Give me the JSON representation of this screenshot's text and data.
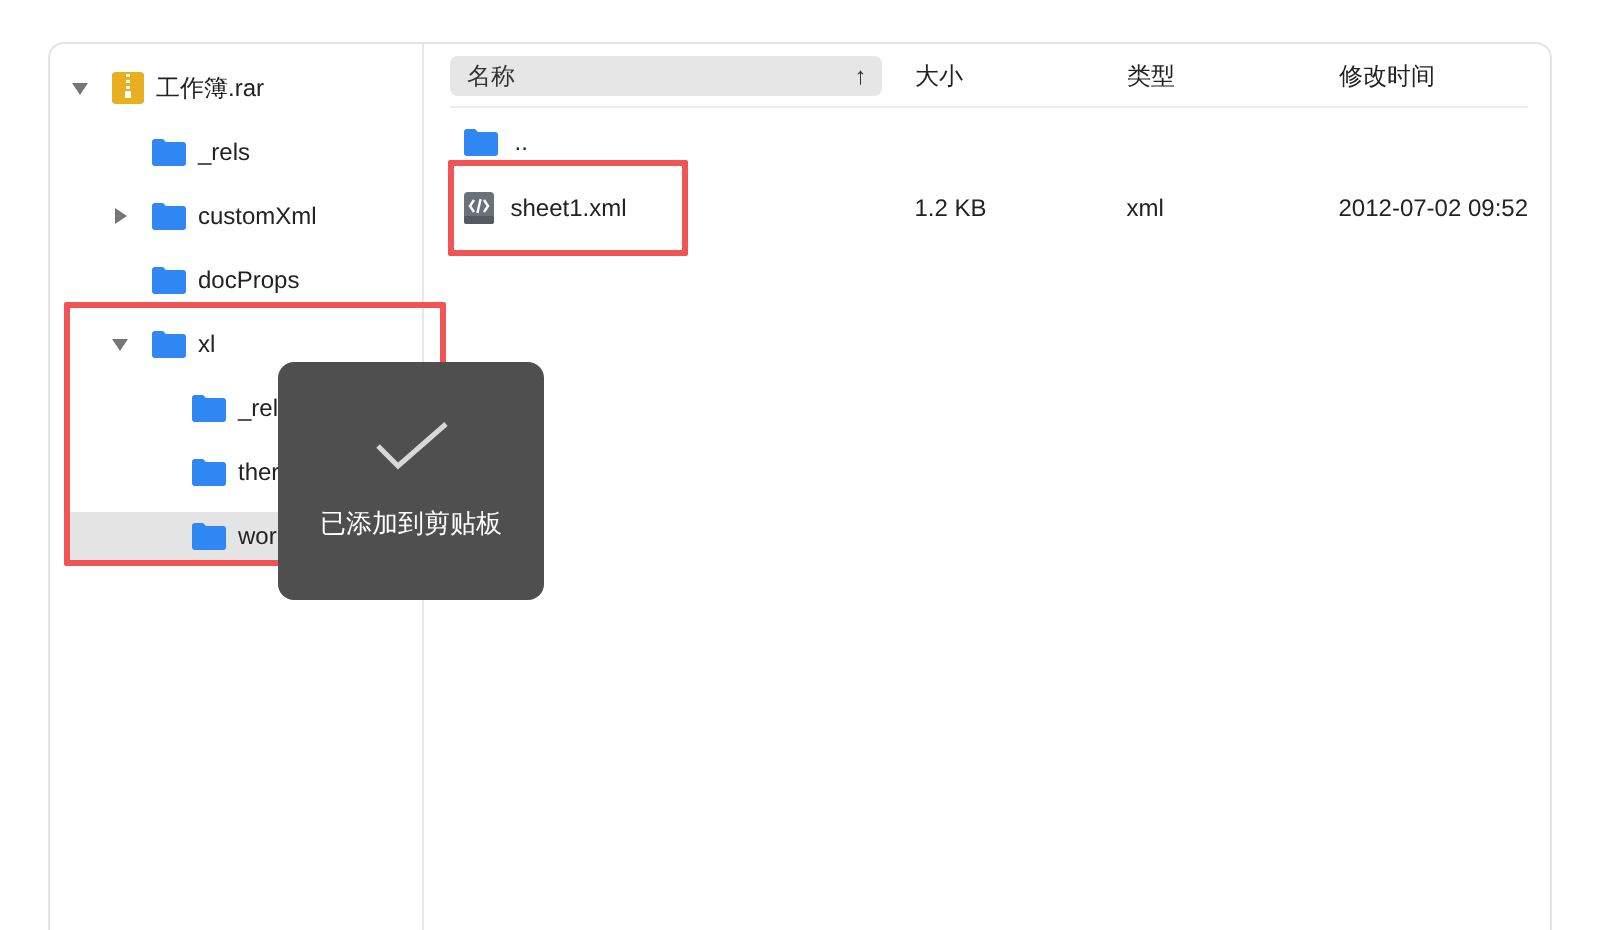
{
  "tree": [
    {
      "label": "工作簿.rar",
      "kind": "archive",
      "expandable": true,
      "expanded": true,
      "selected": false,
      "children": [
        {
          "label": "_rels",
          "kind": "folder",
          "expandable": false,
          "selected": false
        },
        {
          "label": "customXml",
          "kind": "folder",
          "expandable": true,
          "expanded": false,
          "selected": false
        },
        {
          "label": "docProps",
          "kind": "folder",
          "expandable": false,
          "selected": false
        },
        {
          "label": "xl",
          "kind": "folder",
          "expandable": true,
          "expanded": true,
          "selected": false,
          "children": [
            {
              "label": "_rel",
              "kind": "folder",
              "expandable": false,
              "selected": false
            },
            {
              "label": "ther",
              "kind": "folder",
              "expandable": false,
              "selected": false
            },
            {
              "label": "wor",
              "kind": "folder",
              "expandable": false,
              "selected": true
            }
          ]
        }
      ]
    }
  ],
  "table": {
    "columns": [
      {
        "label": "名称",
        "sort": "↑"
      },
      {
        "label": "大小"
      },
      {
        "label": "类型"
      },
      {
        "label": "修改时间"
      }
    ],
    "rows": [
      {
        "kind": "folder",
        "name": "..",
        "selected": false
      },
      {
        "kind": "code-file",
        "name": "sheet1.xml",
        "size": "1.2 KB",
        "type": "xml",
        "modified": "2012-07-02 09:52",
        "selected": false
      }
    ]
  },
  "toast": {
    "message": "已添加到剪贴板"
  },
  "annotations": [
    {
      "kind": "highlight"
    },
    {
      "kind": "highlight"
    }
  ]
}
